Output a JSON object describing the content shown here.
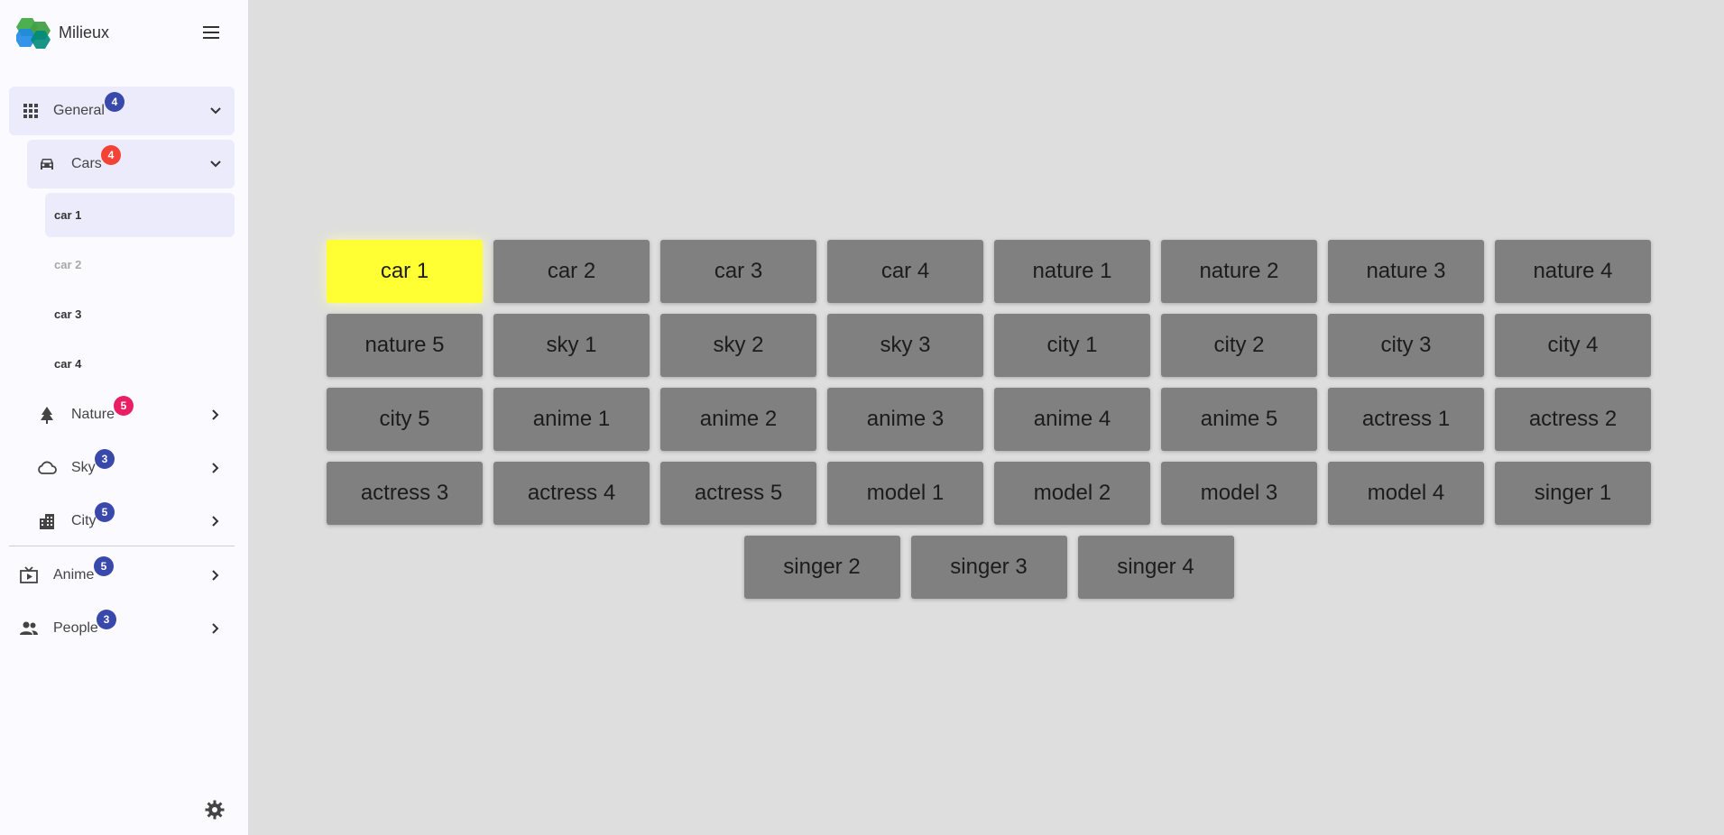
{
  "app": {
    "title": "Milieux"
  },
  "sidebar": {
    "sections": [
      {
        "label": "General",
        "badge": "4",
        "badge_color": "#3949ab",
        "icon": "grid-icon",
        "expanded": true
      },
      {
        "label": "Cars",
        "badge": "4",
        "badge_color": "#f44336",
        "icon": "car-icon",
        "expanded": true
      },
      {
        "label": "Nature",
        "badge": "5",
        "badge_color": "#e91e63",
        "icon": "tree-icon",
        "expanded": false
      },
      {
        "label": "Sky",
        "badge": "3",
        "badge_color": "#3949ab",
        "icon": "cloud-icon",
        "expanded": false
      },
      {
        "label": "City",
        "badge": "5",
        "badge_color": "#3949ab",
        "icon": "city-icon",
        "expanded": false
      },
      {
        "label": "Anime",
        "badge": "5",
        "badge_color": "#3949ab",
        "icon": "tv-icon",
        "expanded": false
      },
      {
        "label": "People",
        "badge": "3",
        "badge_color": "#3949ab",
        "icon": "people-icon",
        "expanded": false
      }
    ],
    "car_items": [
      "car 1",
      "car 2",
      "car 3",
      "car 4"
    ]
  },
  "grid": {
    "selected": "car 1",
    "tiles": [
      "car 1",
      "car 2",
      "car 3",
      "car 4",
      "nature 1",
      "nature 2",
      "nature 3",
      "nature 4",
      "nature 5",
      "sky 1",
      "sky 2",
      "sky 3",
      "city 1",
      "city 2",
      "city 3",
      "city 4",
      "city 5",
      "anime 1",
      "anime 2",
      "anime 3",
      "anime 4",
      "anime 5",
      "actress 1",
      "actress 2",
      "actress 3",
      "actress 4",
      "actress 5",
      "model 1",
      "model 2",
      "model 3",
      "model 4",
      "singer 1",
      "singer 2",
      "singer 3",
      "singer 4"
    ]
  },
  "colors": {
    "accent": "#ffff33",
    "tile": "#808080",
    "background": "#dedede",
    "active_item": "#ecebfb"
  }
}
